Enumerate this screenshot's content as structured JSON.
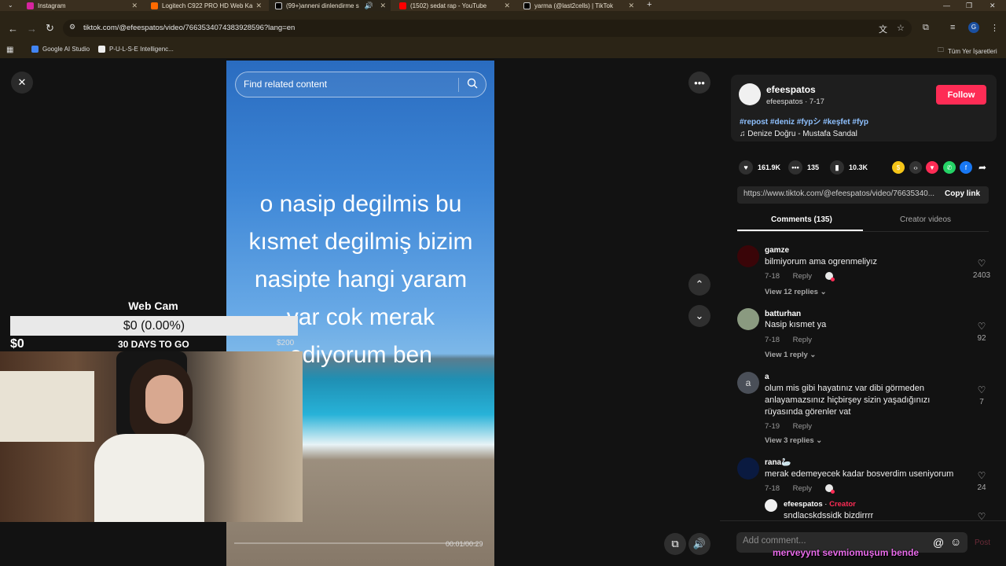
{
  "browser": {
    "tabs": [
      {
        "title": "Instagram",
        "color": "#d6249f"
      },
      {
        "title": "Logitech C922 PRO HD Web Ka",
        "color": "#ff6a00"
      },
      {
        "title": "(99+)anneni dinlendirme s",
        "color": "#000000"
      },
      {
        "title": "(1502) sedat rap - YouTube",
        "color": "#ff0000"
      },
      {
        "title": "yarma (@last2cells) | TikTok",
        "color": "#000000"
      }
    ],
    "new_tab": "+",
    "url": "tiktok.com/@efeespatos/video/7663534074383928596?lang=en",
    "profile_initial": "G",
    "bookmarks": [
      {
        "label": "Google AI Studio"
      },
      {
        "label": "P-U-L-S-E Intelligenc..."
      }
    ],
    "all_bookmarks": "Tüm Yer İşaretleri"
  },
  "video": {
    "search_placeholder": "Find related content",
    "caption": "o nasip degilmis bu kısmet degilmiş bizim nasipte hangi yaram var cok merak ediyorum ben",
    "timecode": "00:01/00:29"
  },
  "webcam": {
    "title": "Web Cam",
    "goal_bar": "$0 (0.00%)",
    "goal_left": "$0",
    "goal_days": "30 DAYS TO GO",
    "goal_right": "$200"
  },
  "post": {
    "author_name": "efeespatos",
    "author_handle": "efeespatos · 7-17",
    "follow_label": "Follow",
    "hashtags": "#repost #deniz #fypシ #keşfet #fyp",
    "music": "Denize Doğru - Mustafa Sandal",
    "stats": {
      "likes": "161.9K",
      "comments": "135",
      "saves": "10.3K"
    },
    "copy_url": "https://www.tiktok.com/@efeespatos/video/76635340...",
    "copy_label": "Copy link",
    "tabs": [
      "Comments (135)",
      "Creator videos"
    ]
  },
  "comments": [
    {
      "user": "gamze",
      "text": "bilmiyorum ama ogrenmeliyız",
      "date": "7-18",
      "reply": "Reply",
      "likes": "2403",
      "view_replies": "View 12 replies"
    },
    {
      "user": "batturhan",
      "text": "Nasip kısmet ya",
      "date": "7-18",
      "reply": "Reply",
      "likes": "92",
      "view_replies": "View 1 reply"
    },
    {
      "user": "a",
      "text": "olum mis gibi hayatınız var dibi görmeden anlayamazsınız hiçbirşey sizin yaşadığınızı rüyasında görenler vat",
      "date": "7-19",
      "reply": "Reply",
      "likes": "7",
      "view_replies": "View 3 replies"
    },
    {
      "user": "rana🦢",
      "text": "merak edemeyecek kadar bosverdim useniyorum",
      "date": "7-18",
      "reply": "Reply",
      "likes": "24"
    }
  ],
  "nested_reply": {
    "user": "efeespatos",
    "creator_tag": "Creator",
    "text": "sndlacskdssidk bizdirrrr"
  },
  "comment_input": {
    "placeholder": "Add comment...",
    "post_label": "Post"
  },
  "stream_overlay": "merveyynt  sevmiomuşum bende"
}
